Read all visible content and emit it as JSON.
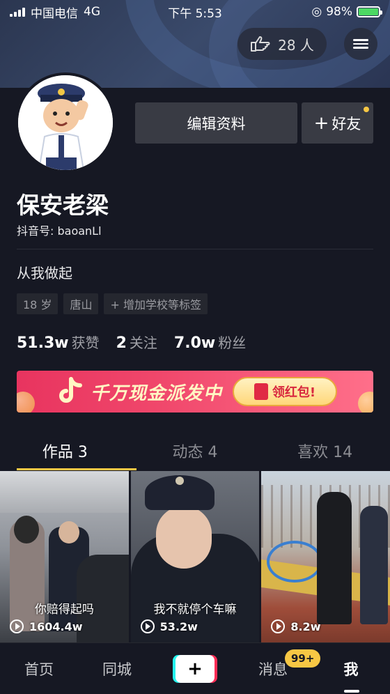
{
  "status_bar": {
    "carrier": "中国电信",
    "network": "4G",
    "time": "下午 5:53",
    "battery": "98%"
  },
  "header": {
    "likes_count": "28 人"
  },
  "profile": {
    "edit_label": "编辑资料",
    "add_friend_label": "好友",
    "name": "保安老梁",
    "douyin_id": "抖音号: baoanLl",
    "bio": "从我做起",
    "tags": [
      "18 岁",
      "唐山",
      "+ 增加学校等标签"
    ],
    "stats": [
      {
        "value": "51.3w",
        "label": "获赞"
      },
      {
        "value": "2",
        "label": "关注"
      },
      {
        "value": "7.0w",
        "label": "粉丝"
      }
    ]
  },
  "banner": {
    "text": "千万现金派发中",
    "button": "领红包!"
  },
  "tabs": [
    "作品 3",
    "动态 4",
    "喜欢 14"
  ],
  "videos": [
    {
      "caption": "你赔得起吗",
      "plays": "1604.4w"
    },
    {
      "caption": "我不就停个车嘛",
      "plays": "53.2w"
    },
    {
      "caption": "",
      "plays": "8.2w"
    }
  ],
  "bottom_nav": {
    "home": "首页",
    "city": "同城",
    "create": "+",
    "messages": "消息",
    "messages_badge": "99+",
    "me": "我"
  },
  "colors": {
    "background": "#161823",
    "accent": "#f7c744",
    "button": "#393b44"
  }
}
